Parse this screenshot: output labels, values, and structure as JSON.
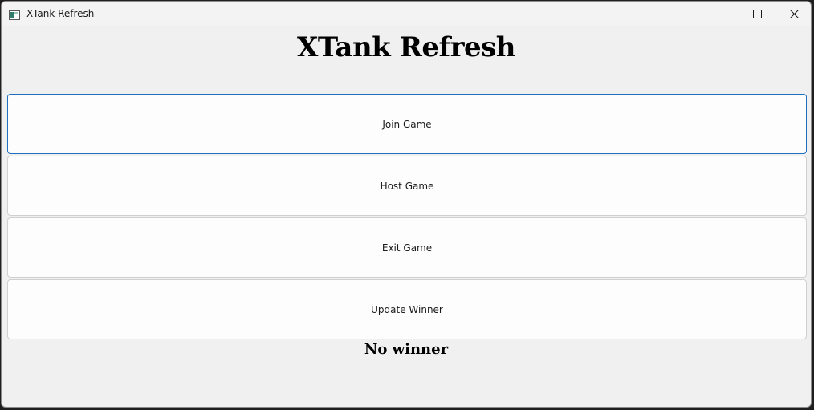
{
  "window": {
    "title": "XTank Refresh",
    "controls": {
      "minimize_icon": "minimize-icon",
      "maximize_icon": "maximize-icon",
      "close_icon": "close-icon"
    }
  },
  "main": {
    "heading": "XTank Refresh",
    "buttons": {
      "join": "Join Game",
      "host": "Host Game",
      "exit": "Exit Game",
      "update": "Update Winner"
    },
    "status": "No winner"
  },
  "colors": {
    "focus_border": "#1f6fbf",
    "window_bg": "#f0f0f0",
    "button_bg": "#fdfdfd"
  }
}
